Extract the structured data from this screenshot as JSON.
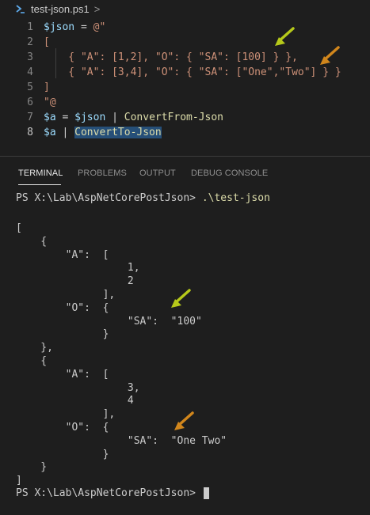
{
  "breadcrumb": {
    "file": "test-json.ps1",
    "separator": ">",
    "icon": "powershell-icon"
  },
  "editor": {
    "lines": [
      {
        "num": "1",
        "segments": [
          {
            "t": "$json",
            "c": "var"
          },
          {
            "t": " = ",
            "c": "op"
          },
          {
            "t": "@\"",
            "c": "str"
          }
        ]
      },
      {
        "num": "2",
        "segments": [
          {
            "t": "[",
            "c": "str"
          }
        ]
      },
      {
        "num": "3",
        "segments": [
          {
            "t": "    { \"A\": [1,2], \"O\": { \"SA\": [100] } },",
            "c": "str"
          }
        ]
      },
      {
        "num": "4",
        "segments": [
          {
            "t": "    { \"A\": [3,4], \"O\": { \"SA\": [\"One\",\"Two\"] } }",
            "c": "str"
          }
        ]
      },
      {
        "num": "5",
        "segments": [
          {
            "t": "]",
            "c": "str"
          }
        ]
      },
      {
        "num": "6",
        "segments": [
          {
            "t": "\"@",
            "c": "str"
          }
        ]
      },
      {
        "num": "7",
        "segments": [
          {
            "t": "$a",
            "c": "var"
          },
          {
            "t": " = ",
            "c": "op"
          },
          {
            "t": "$json",
            "c": "var"
          },
          {
            "t": " | ",
            "c": "op"
          },
          {
            "t": "ConvertFrom-Json",
            "c": "cmd"
          }
        ]
      },
      {
        "num": "8",
        "segments": [
          {
            "t": "$a",
            "c": "var"
          },
          {
            "t": " | ",
            "c": "op"
          },
          {
            "t": "ConvertTo-Json",
            "c": "cmd hl"
          }
        ]
      }
    ]
  },
  "panel": {
    "tabs": [
      "TERMINAL",
      "PROBLEMS",
      "OUTPUT",
      "DEBUG CONSOLE"
    ],
    "active_tab": "TERMINAL"
  },
  "terminal": {
    "prompt": "PS X:\\Lab\\AspNetCorePostJson> ",
    "command": ".\\test-json",
    "output": [
      "[",
      "    {",
      "        \"A\":  [",
      "                  1,",
      "                  2",
      "              ],",
      "        \"O\":  {",
      "                  \"SA\":  \"100\"",
      "              }",
      "    },",
      "    {",
      "        \"A\":  [",
      "                  3,",
      "                  4",
      "              ],",
      "        \"O\":  {",
      "                  \"SA\":  \"One Two\"",
      "              }",
      "    }",
      "]"
    ],
    "final_prompt": "PS X:\\Lab\\AspNetCorePostJson> "
  },
  "colors": {
    "arrow_green": "#b6c91a",
    "arrow_orange": "#d1861c"
  }
}
